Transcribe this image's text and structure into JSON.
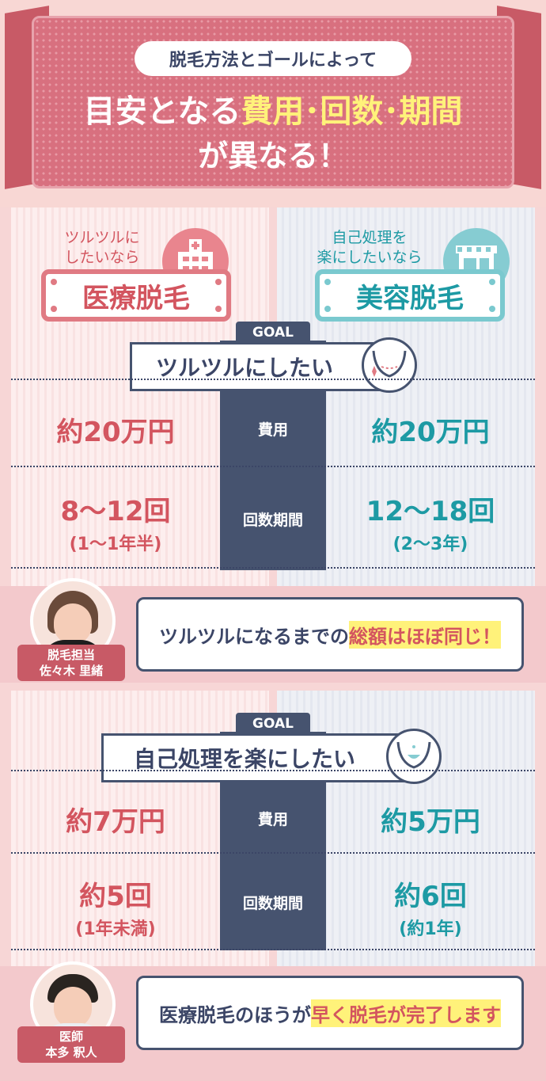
{
  "header": {
    "subtitle": "脱毛方法とゴールによって",
    "title_pre": "目安となる",
    "title_highlight": "費用･回数･期間",
    "title_line2": "が異なる！"
  },
  "categories": {
    "medical": {
      "catch_line1": "ツルツルに",
      "catch_line2": "したいなら",
      "label": "医療脱毛",
      "icon": "hospital-icon"
    },
    "beauty": {
      "catch_line1": "自己処理を",
      "catch_line2": "楽にしたいなら",
      "label": "美容脱毛",
      "icon": "salon-icon"
    }
  },
  "goal1": {
    "tag": "GOAL",
    "title": "ツルツルにしたい",
    "cost_label": "費用",
    "times_label": "回数期間",
    "medical_cost": "約20万円",
    "beauty_cost": "約20万円",
    "medical_times": "8～12回",
    "medical_period": "(1～1年半)",
    "beauty_times": "12～18回",
    "beauty_period": "(2～3年)"
  },
  "advisor1": {
    "role": "脱毛担当",
    "name": "佐々木 里緒",
    "comment_pre": "ツルツルになるまでの",
    "comment_highlight": "総額はほぼ同じ！"
  },
  "goal2": {
    "tag": "GOAL",
    "title": "自己処理を楽にしたい",
    "cost_label": "費用",
    "times_label": "回数期間",
    "medical_cost": "約7万円",
    "beauty_cost": "約5万円",
    "medical_times": "約5回",
    "medical_period": "(1年未満)",
    "beauty_times": "約6回",
    "beauty_period": "(約1年)"
  },
  "advisor2": {
    "role": "医師",
    "name": "本多 釈人",
    "comment_pre": "医療脱毛のほうが",
    "comment_highlight": "早く脱毛が完了します"
  },
  "colors": {
    "pink": "#d3555f",
    "teal": "#1d9aa4",
    "navy": "#46536f",
    "highlight": "#fff27a"
  }
}
